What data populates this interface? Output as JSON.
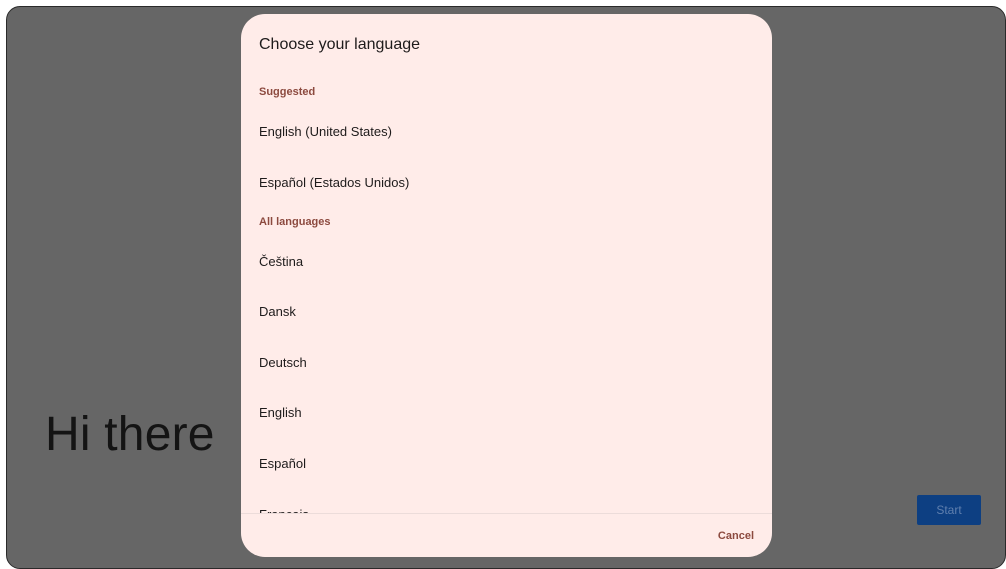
{
  "background_screen": {
    "greeting": "Hi there",
    "start_button_label": "Start"
  },
  "dialog": {
    "title": "Choose your language",
    "sections": {
      "suggested_header": "Suggested",
      "all_header": "All languages"
    },
    "suggested": [
      "English (United States)",
      "Español (Estados Unidos)"
    ],
    "all_languages": [
      "Čeština",
      "Dansk",
      "Deutsch",
      "English",
      "Español",
      "Français"
    ],
    "cancel_label": "Cancel"
  },
  "colors": {
    "dialog_background": "#ffece9",
    "accent_text": "#8c4a3f",
    "scrim": "#666666",
    "start_button": "#0d3f82"
  }
}
